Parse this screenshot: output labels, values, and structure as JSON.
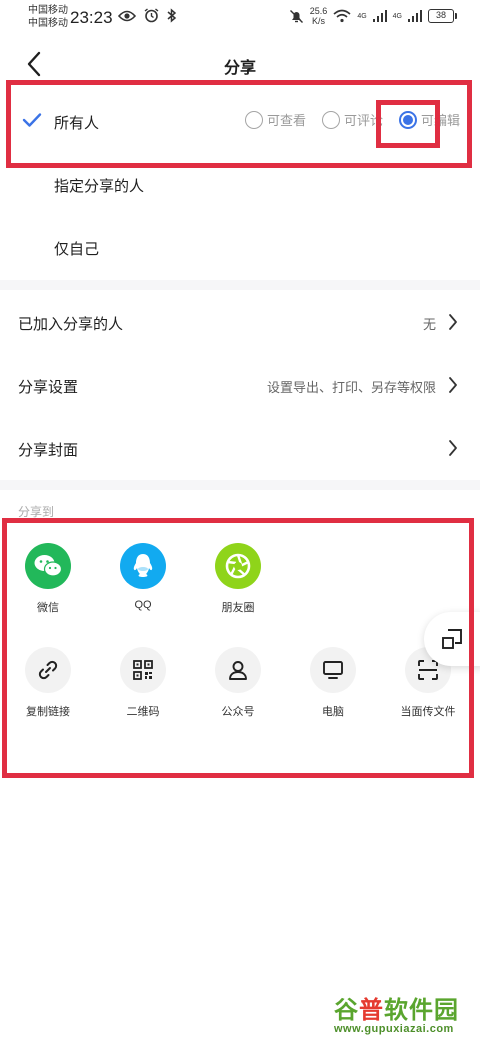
{
  "status_bar": {
    "carrier_1": "中国移动",
    "carrier_2": "中国移动",
    "time": "23:23",
    "net_speed_value": "25.6",
    "net_speed_unit": "K/s",
    "signal_1": "4G",
    "signal_2": "4G",
    "battery": "38"
  },
  "header": {
    "title": "分享"
  },
  "visibility": {
    "options": [
      {
        "label": "所有人",
        "selected": true
      },
      {
        "label": "指定分享的人",
        "selected": false
      },
      {
        "label": "仅自己",
        "selected": false
      }
    ],
    "permissions": [
      {
        "label": "可查看",
        "selected": false
      },
      {
        "label": "可评论",
        "selected": false
      },
      {
        "label": "可编辑",
        "selected": true
      }
    ]
  },
  "settings": {
    "joined": {
      "label": "已加入分享的人",
      "value": "无"
    },
    "share_settings": {
      "label": "分享设置",
      "value": "设置导出、打印、另存等权限"
    },
    "cover": {
      "label": "分享封面"
    }
  },
  "share_to": {
    "title": "分享到",
    "row1": [
      {
        "label": "微信",
        "icon": "wechat-icon",
        "color": "#22b85a"
      },
      {
        "label": "QQ",
        "icon": "qq-icon",
        "color": "#12aaf0"
      },
      {
        "label": "朋友圈",
        "icon": "moments-icon",
        "color": "#8fd41a"
      }
    ],
    "row2": [
      {
        "label": "复制链接",
        "icon": "link-icon"
      },
      {
        "label": "二维码",
        "icon": "qr-code-icon"
      },
      {
        "label": "公众号",
        "icon": "official-account-icon"
      },
      {
        "label": "电脑",
        "icon": "computer-icon"
      },
      {
        "label": "当面传文件",
        "icon": "scan-icon"
      }
    ]
  },
  "colors": {
    "accent": "#3b73e6",
    "annotation": "#e02e42"
  },
  "watermark": {
    "name_part1": "谷",
    "name_part2": "普",
    "name_part3": "软件园",
    "url": "www.gupuxiazai.com"
  }
}
